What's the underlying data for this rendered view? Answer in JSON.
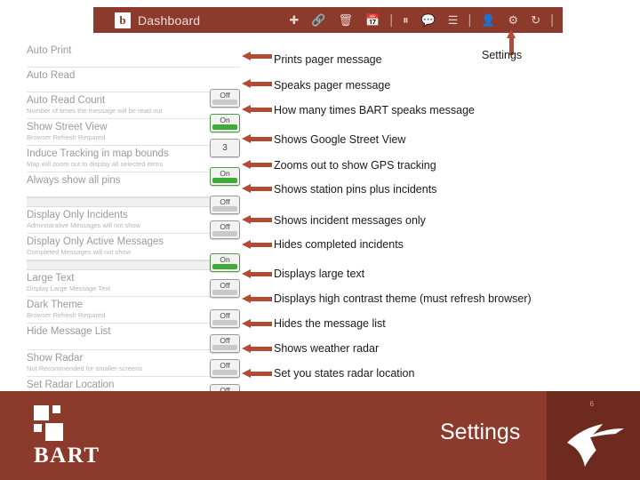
{
  "topbar": {
    "logo": "b",
    "title": "Dashboard",
    "icons": [
      "plus-icon",
      "link-icon",
      "trash-icon",
      "calendar-icon",
      "divider",
      "pause-icon",
      "message-icon",
      "list-icon",
      "divider",
      "user-icon",
      "gear-icon",
      "refresh-icon",
      "divider"
    ]
  },
  "settings": {
    "rows": [
      {
        "label": "Auto Print",
        "sub": "",
        "control": "toggle",
        "value": "Off",
        "state": "off"
      },
      {
        "label": "Auto Read",
        "sub": "",
        "control": "toggle",
        "value": "On",
        "state": "on"
      },
      {
        "label": "Auto Read Count",
        "sub": "Number of times the message will be read out",
        "control": "number",
        "value": "3",
        "state": "num"
      },
      {
        "label": "Show Street View",
        "sub": "Browser Refresh Required",
        "control": "toggle",
        "value": "On",
        "state": "on"
      },
      {
        "label": "Induce Tracking in map bounds",
        "sub": "Map will zoom out to display all selected items",
        "control": "toggle",
        "value": "Off",
        "state": "off"
      },
      {
        "label": "Always show all pins",
        "sub": "",
        "control": "toggle",
        "value": "Off",
        "state": "off"
      },
      {
        "label": "Display Only Incidents",
        "sub": "Administrative Messages will not show",
        "control": "toggle",
        "value": "On",
        "state": "on"
      },
      {
        "label": "Display Only Active Messages",
        "sub": "Completed Messages will not show",
        "control": "toggle",
        "value": "Off",
        "state": "off"
      },
      {
        "label": "Large Text",
        "sub": "Display Large Message Text",
        "control": "toggle",
        "value": "Off",
        "state": "off"
      },
      {
        "label": "Dark Theme",
        "sub": "Browser Refresh Required",
        "control": "toggle",
        "value": "Off",
        "state": "off"
      },
      {
        "label": "Hide Message List",
        "sub": "",
        "control": "toggle",
        "value": "Off",
        "state": "off"
      },
      {
        "label": "Show Radar",
        "sub": "Not Recommended for smaller screens",
        "control": "toggle",
        "value": "Off",
        "state": "off"
      },
      {
        "label": "Set Radar Location",
        "sub": "",
        "control": "chevron",
        "value": "›",
        "state": "chevron"
      }
    ]
  },
  "annotations": {
    "settings_callout": "Settings",
    "notes": [
      "Prints pager message",
      "Speaks pager message",
      "How many times BART speaks message",
      "Shows Google Street View",
      "Zooms out to show GPS tracking",
      "Shows station pins plus incidents",
      "Shows incident messages only",
      "Hides completed incidents",
      "Displays large text",
      "Displays high contrast theme (must refresh browser)",
      "Hides the message list",
      "Shows weather radar",
      "Set you states radar location"
    ]
  },
  "footer": {
    "brand_mark": "b",
    "brand_word": "BART",
    "section_title": "Settings",
    "page_number": "6"
  },
  "colors": {
    "brand": "#8c3a2b",
    "brand_dark": "#6e2a1f",
    "arrow": "#b34a33",
    "toggle_on": "#3faa35"
  }
}
